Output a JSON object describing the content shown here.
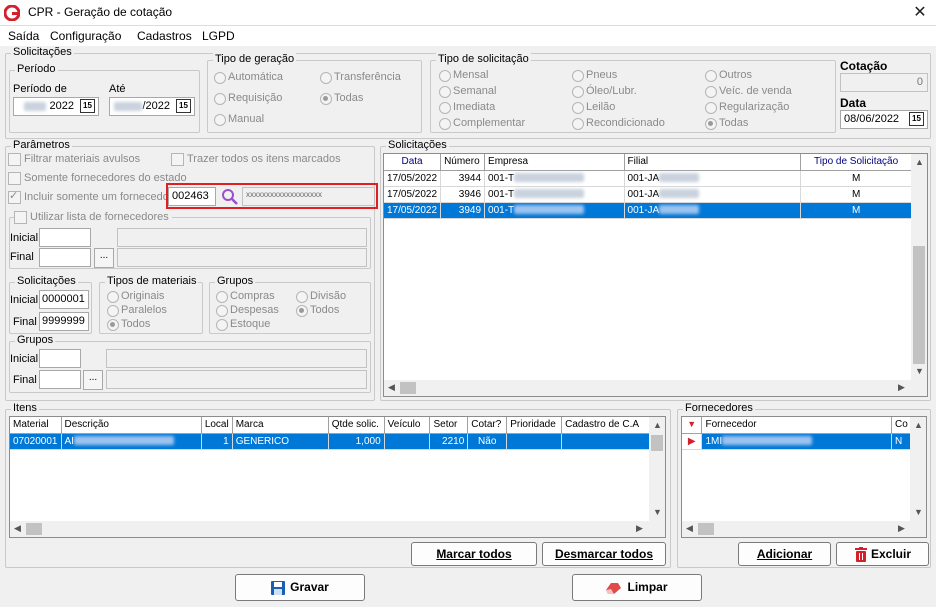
{
  "window": {
    "title": "CPR - Geração de cotação",
    "close": "✕"
  },
  "menu": [
    "Saída",
    "Configuração",
    "Cadastros",
    "LGPD"
  ],
  "solicitacoes_group": {
    "legend": "Solicitações",
    "periodo": {
      "legend": "Período",
      "de_label": "Período de",
      "de_value": "2022",
      "ate_label": "Até",
      "ate_value": "/2022",
      "cal_icon": "15"
    },
    "tipo_geracao": {
      "legend": "Tipo de geração",
      "options": [
        "Automática",
        "Transferência",
        "Requisição",
        "Todas",
        "Manual"
      ],
      "selected": "Todas"
    },
    "tipo_solicitacao": {
      "legend": "Tipo de solicitação",
      "options": [
        "Mensal",
        "Pneus",
        "Outros",
        "Semanal",
        "Óleo/Lubr.",
        "Veíc. de venda",
        "Imediata",
        "Leilão",
        "Regularização",
        "Complementar",
        "Recondicionado",
        "Todas"
      ],
      "selected": "Todas"
    },
    "cotacao": {
      "label": "Cotação",
      "value": "0"
    },
    "data": {
      "label": "Data",
      "value": "08/06/2022",
      "cal_icon": "15"
    }
  },
  "parametros": {
    "legend": "Parâmetros",
    "filtrar": "Filtrar materiais avulsos",
    "trazer": "Trazer todos os itens marcados",
    "somente_estado": "Somente fornecedores do estado",
    "incluir": "Incluir somente um fornecedor",
    "fornecedor_code": "002463",
    "fornecedor_name": "xxxxxxxxxxxxxxxxxxx",
    "utilizar": "Utilizar lista de fornecedores",
    "inicial": "Inicial",
    "final": "Final",
    "dots": "...",
    "sol_legend": "Solicitações",
    "sol_inicial": "0000001",
    "sol_final": "9999999",
    "tipos_legend": "Tipos de materiais",
    "tipos_options": [
      "Originais",
      "Paralelos",
      "Todos"
    ],
    "grupos_legend": "Grupos",
    "grupos_options": [
      "Compras",
      "Divisão",
      "Despesas",
      "Todos",
      "Estoque"
    ],
    "grupos2_legend": "Grupos"
  },
  "solicitacoes_list": {
    "legend": "Solicitações",
    "columns": [
      "Data",
      "Número",
      "Empresa",
      "Filial",
      "Tipo de Solicitação"
    ],
    "rows": [
      {
        "data": "17/05/2022",
        "numero": "3944",
        "empresa": "001-T",
        "filial": "001-JA",
        "tipo": "M"
      },
      {
        "data": "17/05/2022",
        "numero": "3946",
        "empresa": "001-T",
        "filial": "001-JA",
        "tipo": "M"
      },
      {
        "data": "17/05/2022",
        "numero": "3949",
        "empresa": "001-T",
        "filial": "001-JA",
        "tipo": "M"
      }
    ]
  },
  "itens": {
    "legend": "Itens",
    "columns": [
      "Material",
      "Descrição",
      "Local",
      "Marca",
      "Qtde solic.",
      "Veículo",
      "Setor",
      "Cotar?",
      "Prioridade",
      "Cadastro de C.A"
    ],
    "rows": [
      {
        "material": "07020001",
        "descricao": "AI",
        "local": "1",
        "marca": "GENERICO",
        "qtde": "1,000",
        "veiculo": "",
        "setor": "2210",
        "cotar": "Não",
        "prioridade": "",
        "cadastro": ""
      }
    ],
    "marcar": "Marcar todos",
    "desmarcar": "Desmarcar todos"
  },
  "fornecedores": {
    "legend": "Fornecedores",
    "columns": [
      "Fornecedor",
      "Co"
    ],
    "rows": [
      {
        "fornecedor": "1MI",
        "co": "N"
      }
    ],
    "adicionar": "Adicionar",
    "excluir": "Excluir"
  },
  "footer": {
    "gravar": "Gravar",
    "limpar": "Limpar"
  },
  "colors": {
    "selection": "#0078d7",
    "highlight_border": "#e02020",
    "search_icon": "#9b4fd0"
  }
}
